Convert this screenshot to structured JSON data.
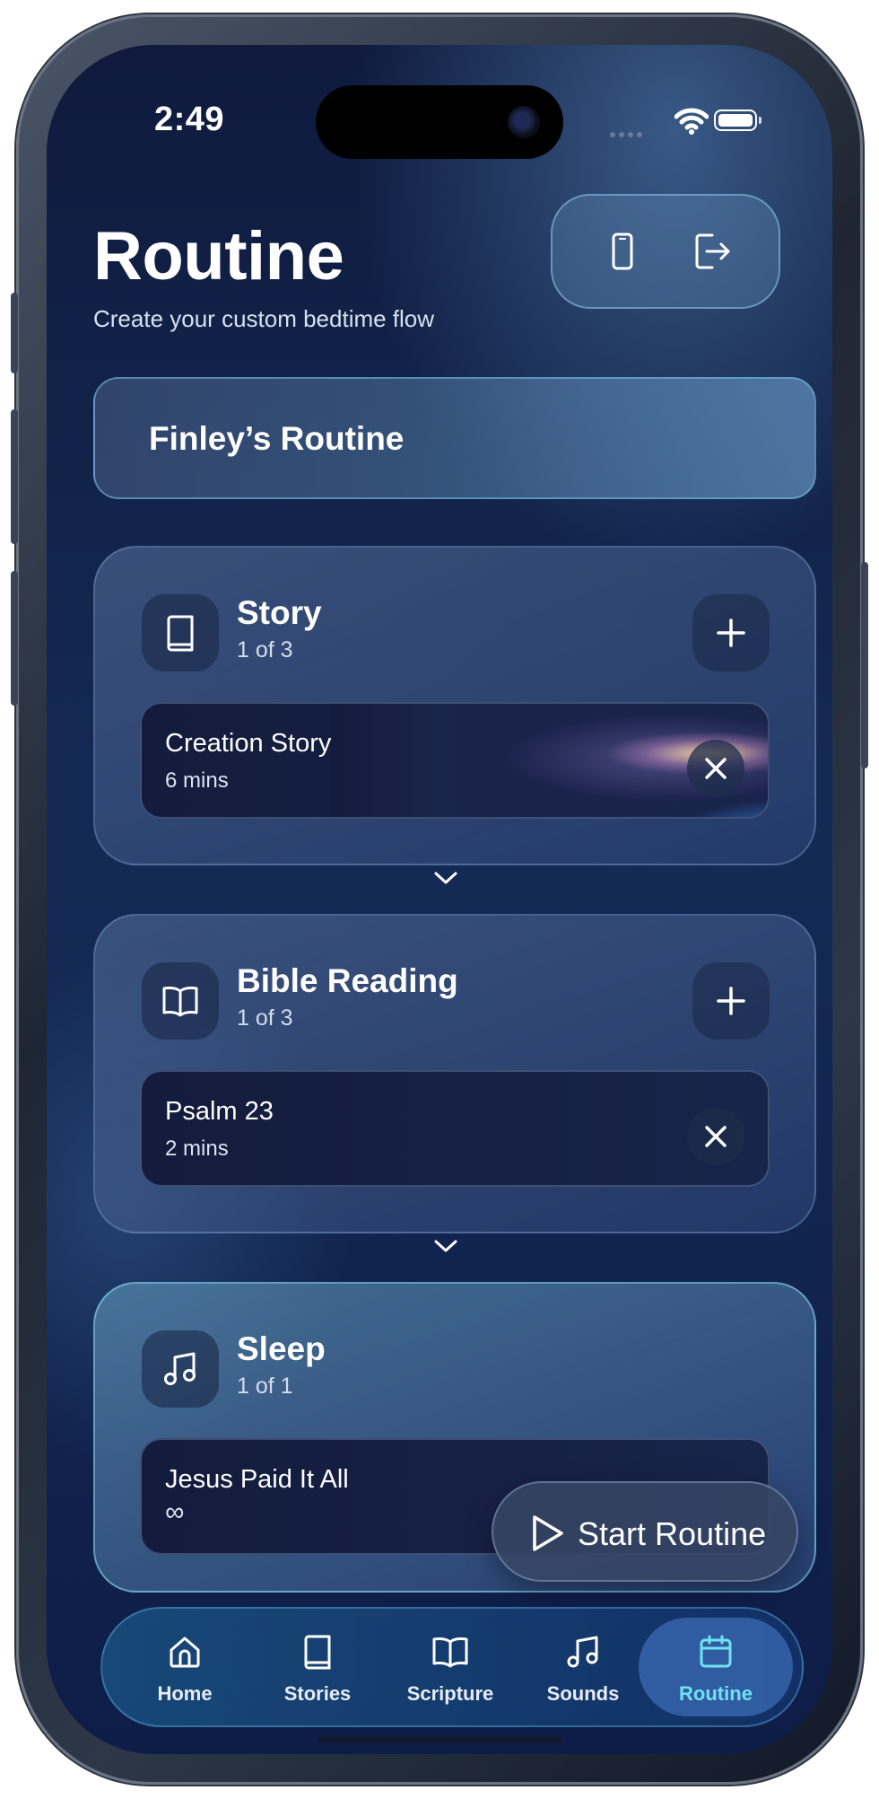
{
  "status_bar": {
    "time": "2:49"
  },
  "header": {
    "title": "Routine",
    "subtitle": "Create your custom bedtime flow",
    "actions": [
      {
        "icon": "phone-icon"
      },
      {
        "icon": "logout-icon"
      }
    ]
  },
  "routine_name": "Finley’s Routine",
  "sections": [
    {
      "icon": "book-icon",
      "title": "Story",
      "count": "1 of 3",
      "item": {
        "title": "Creation Story",
        "meta": "6 mins"
      }
    },
    {
      "icon": "open-book-icon",
      "title": "Bible Reading",
      "count": "1 of 3",
      "item": {
        "title": "Psalm 23",
        "meta": "2 mins"
      }
    },
    {
      "icon": "music-note-icon",
      "title": "Sleep",
      "count": "1 of 1",
      "item": {
        "title": "Jesus Paid It All",
        "meta": "∞"
      }
    }
  ],
  "start_button": {
    "label": "Start Routine"
  },
  "tabbar": {
    "tabs": [
      {
        "label": "Home",
        "icon": "home-icon"
      },
      {
        "label": "Stories",
        "icon": "book-icon"
      },
      {
        "label": "Scripture",
        "icon": "open-book-icon"
      },
      {
        "label": "Sounds",
        "icon": "music-note-icon"
      },
      {
        "label": "Routine",
        "icon": "calendar-icon",
        "active": true
      }
    ]
  },
  "colors": {
    "active_tab": "#6fe3f2",
    "background_top": "#0f1a3d",
    "background_bottom": "#0e1d48"
  }
}
